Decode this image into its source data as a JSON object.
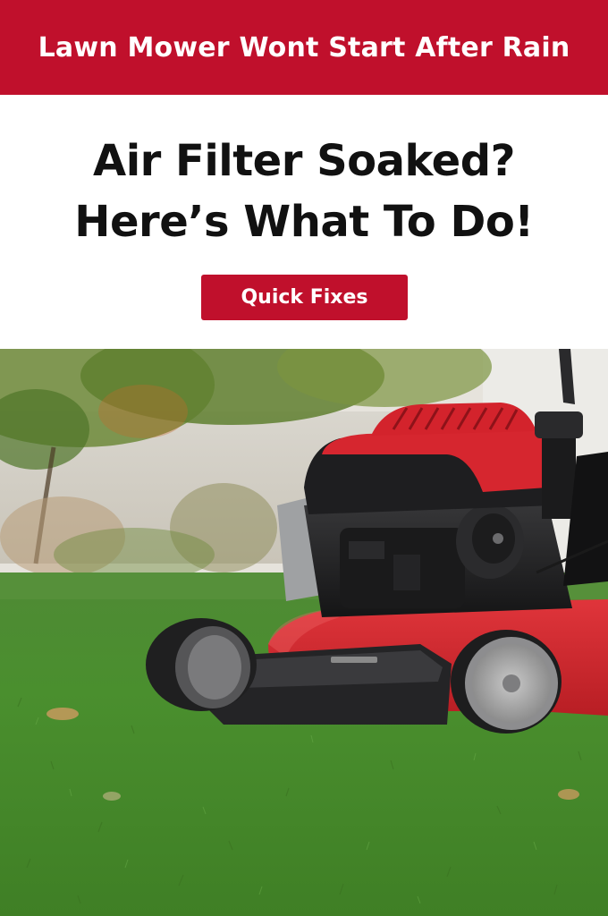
{
  "banner": {
    "title": "Lawn Mower Wont Start After Rain"
  },
  "headline": {
    "line1": "Air Filter Soaked?",
    "line2": "Here’s What To Do!"
  },
  "cta": {
    "label": "Quick Fixes"
  },
  "colors": {
    "accent_red": "#c0102c",
    "headline_text": "#111111",
    "background": "#ffffff"
  }
}
